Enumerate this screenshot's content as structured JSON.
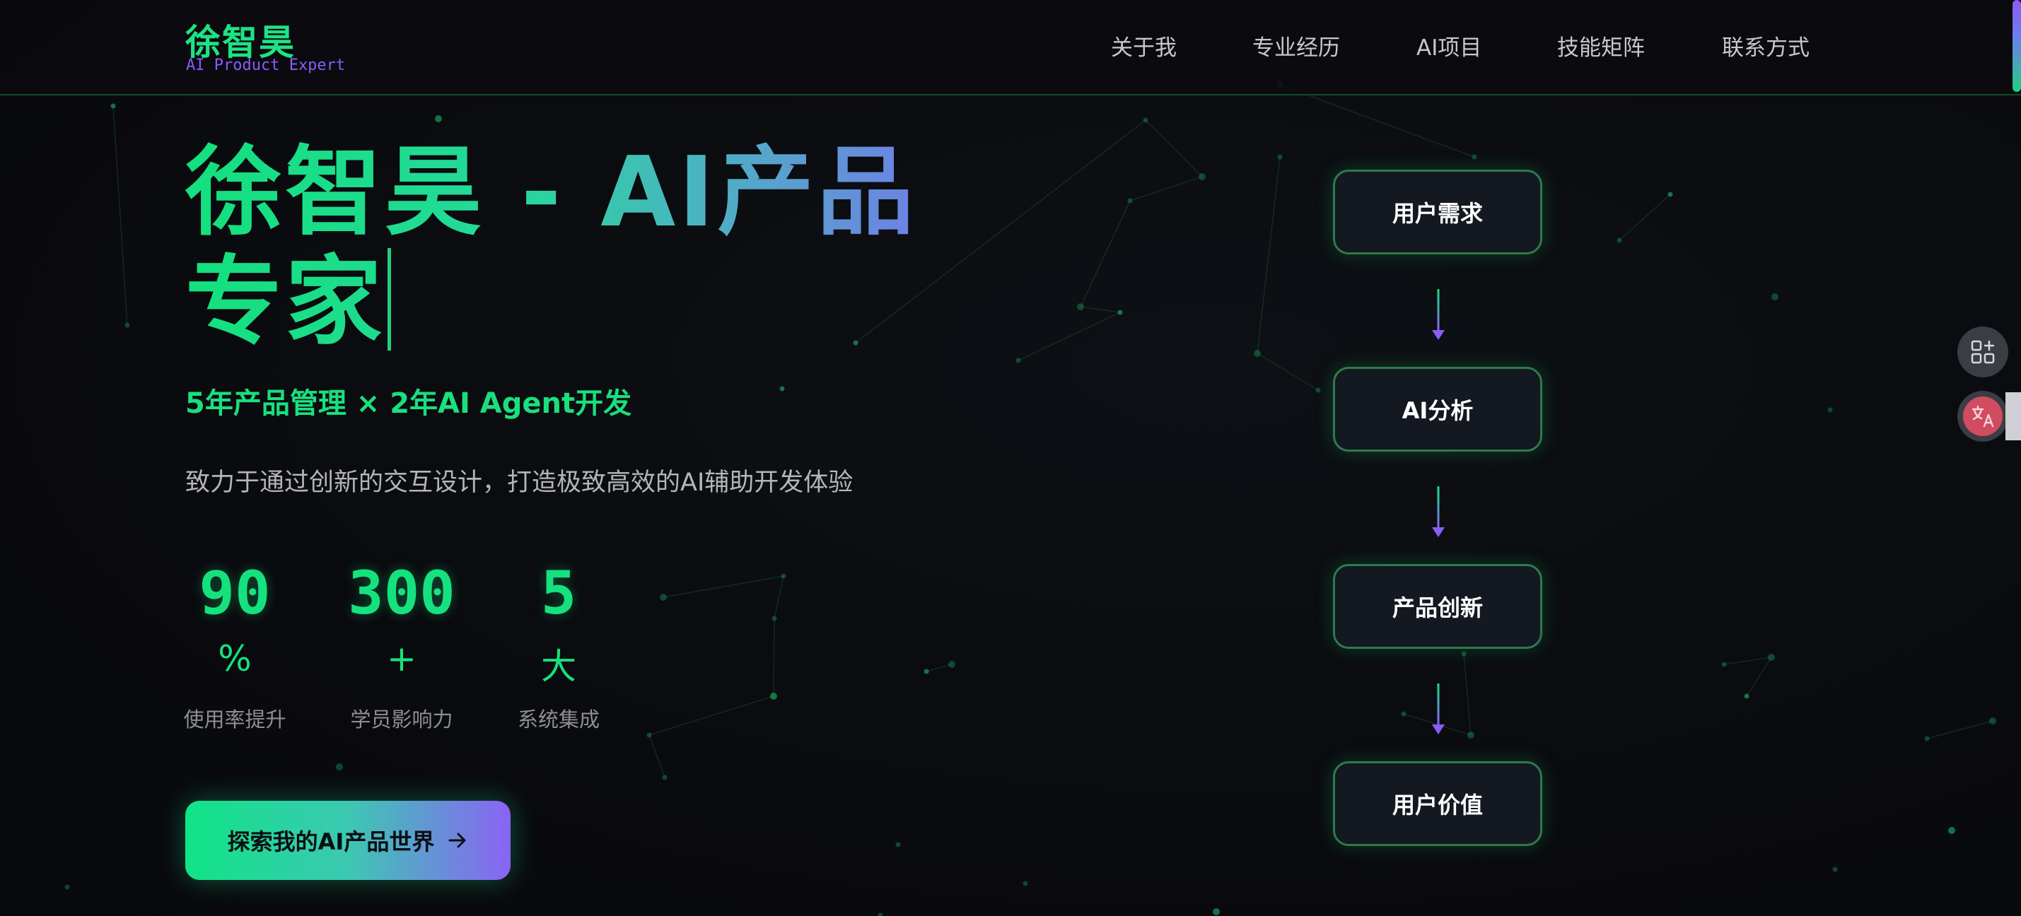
{
  "header": {
    "brand_name": "徐智昊",
    "brand_tagline": "AI Product Expert",
    "nav_items": [
      "关于我",
      "专业经历",
      "AI项目",
      "技能矩阵",
      "联系方式"
    ]
  },
  "hero": {
    "title": "徐智昊 - AI产品专家",
    "subtitle": "5年产品管理 × 2年AI Agent开发",
    "description": "致力于通过创新的交互设计，打造极致高效的AI辅助开发体验",
    "stats": [
      {
        "value": "90",
        "unit": "%",
        "label": "使用率提升"
      },
      {
        "value": "300",
        "unit": "+",
        "label": "学员影响力"
      },
      {
        "value": "5",
        "unit": "大",
        "label": "系统集成"
      }
    ],
    "cta_label": "探索我的AI产品世界",
    "cta_icon": "arrow-right-icon"
  },
  "flow": {
    "steps": [
      "用户需求",
      "AI分析",
      "产品创新",
      "用户价值"
    ],
    "arrow_icon": "arrow-down-icon"
  },
  "floating": {
    "tools_icon": "apps-add-icon",
    "translate_icon": "translate-icon"
  },
  "colors": {
    "accent_green": "#15e27e",
    "accent_purple": "#8b5cf6",
    "background": "#0a0b0f"
  }
}
